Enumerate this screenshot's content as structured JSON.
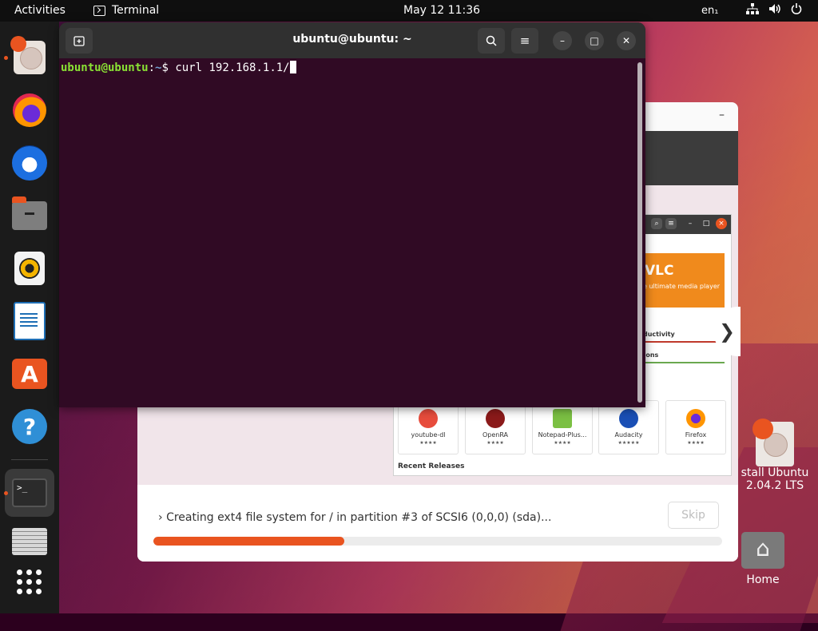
{
  "topbar": {
    "activities": "Activities",
    "app_name": "Terminal",
    "clock": "May 12  11:36",
    "lang": "en₁",
    "tray_icons": [
      "network-icon",
      "volume-icon",
      "power-icon"
    ]
  },
  "dock": {
    "items": [
      "ubuntu-installer",
      "firefox",
      "thunderbird",
      "files",
      "rhythmbox",
      "libreoffice-writer",
      "ubuntu-software",
      "help",
      "terminal",
      "disk-utility",
      "show-applications"
    ],
    "terminal_glyph": ">_"
  },
  "terminal": {
    "title": "ubuntu@ubuntu: ~",
    "prompt_user": "ubuntu@ubuntu",
    "prompt_sep": ":",
    "prompt_path": "~",
    "prompt_symbol": "$ ",
    "command": "curl 192.168.1.1/"
  },
  "installer": {
    "slide": {
      "vlc_title": "VLC",
      "vlc_subtitle": "e ultimate media player",
      "category_1": "ductivity",
      "category_2": "-ons",
      "apps": [
        {
          "name": "youtube-dl",
          "stars": "★★★★"
        },
        {
          "name": "OpenRA",
          "stars": "★★★★"
        },
        {
          "name": "Notepad-Plus...",
          "stars": "★★★★"
        },
        {
          "name": "Audacity",
          "stars": "★★★★★"
        },
        {
          "name": "Firefox",
          "stars": "★★★★"
        }
      ],
      "recent_releases": "Recent Releases",
      "next_arrow": "❯"
    },
    "status_text": "Creating ext4 file system for / in partition #3 of SCSI6 (0,0,0) (sda)...",
    "skip_label": "Skip",
    "progress": 0.335
  },
  "desktop": {
    "install_label_line1": "stall Ubuntu",
    "install_label_line2": "2.04.2 LTS",
    "home_label": "Home"
  },
  "colors": {
    "accent": "#e95420",
    "terminal_bg": "#300a24"
  }
}
